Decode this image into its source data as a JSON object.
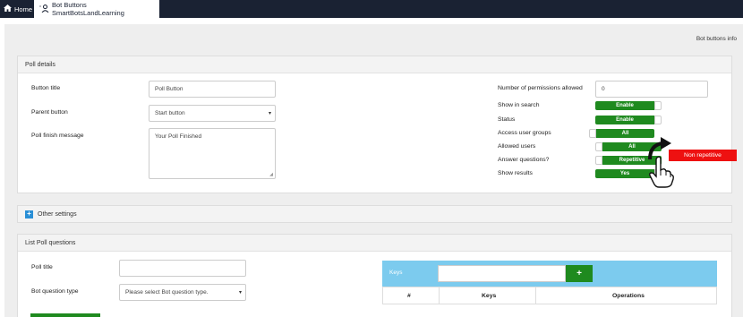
{
  "tabs": {
    "home": "Home",
    "active": "Bot Buttons SmartBotsLandLearning"
  },
  "page": {
    "info_link": "Bot buttons info"
  },
  "poll_details": {
    "header": "Poll details",
    "button_title_label": "Button title",
    "button_title_value": "Poll Button",
    "parent_button_label": "Parent button",
    "parent_button_value": "Start button",
    "finish_message_label": "Poll finish message",
    "finish_message_value": "Your Poll Finished",
    "permissions_label": "Number of permissions allowed",
    "permissions_value": "0",
    "show_in_search_label": "Show in search",
    "show_in_search_value": "Enable",
    "status_label": "Status",
    "status_value": "Enable",
    "access_groups_label": "Access user groups",
    "access_groups_value": "All",
    "allowed_users_label": "Allowed users",
    "allowed_users_value": "All",
    "answer_questions_label": "Answer questions?",
    "answer_questions_value": "Repetitive",
    "show_results_label": "Show results",
    "show_results_value": "Yes",
    "callout": "Non repetitive"
  },
  "other_settings": {
    "header": "Other settings"
  },
  "list_poll_questions": {
    "header": "List Poll questions",
    "poll_title_label": "Poll title",
    "poll_title_value": "",
    "question_type_label": "Bot question type",
    "question_type_value": "Please select Bot question type.",
    "keys_label": "Keys",
    "keys_input_value": "",
    "plus_label": "+",
    "columns": [
      "#",
      "Keys",
      "Operations"
    ]
  },
  "colors": {
    "topbar": "#1a2233",
    "accent_green": "#1f8a1f",
    "keys_bar": "#7ccbee",
    "callout_red": "#ee1111"
  }
}
